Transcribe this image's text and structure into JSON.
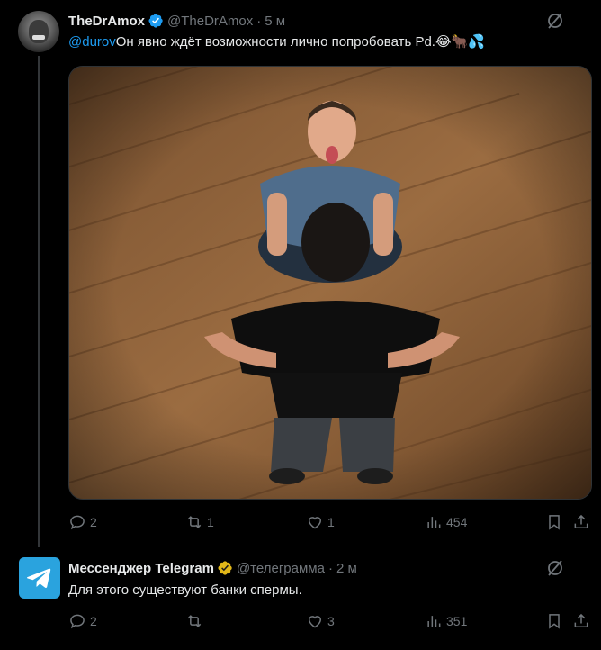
{
  "tweet": {
    "author_name": "TheDrAmox",
    "author_handle": "@TheDrAmox",
    "separator": "·",
    "time": "5 м",
    "mention": "@durov",
    "text": "Он явно ждёт возможности лично попробовать Pd.",
    "emoji": "😂🐂💦",
    "stats": {
      "replies": "2",
      "reposts": "1",
      "likes": "1",
      "views": "454"
    }
  },
  "reply": {
    "author_name": "Мессенджер Telegram",
    "author_handle": "@телеграмма",
    "separator": "·",
    "time": "2 м",
    "text": "Для этого существуют банки спермы.",
    "stats": {
      "replies": "2",
      "reposts": "",
      "likes": "3",
      "views": "351"
    }
  },
  "colors": {
    "background": "#000000",
    "text": "#e7e9ea",
    "muted": "#71767b",
    "accent": "#1d9bf0",
    "verified_gold": "#e2b719",
    "telegram": "#2aa3de"
  },
  "icons": [
    "verified-badge-icon",
    "grok-icon",
    "reply-icon",
    "repost-icon",
    "like-icon",
    "views-icon",
    "bookmark-icon",
    "share-icon",
    "telegram-icon"
  ]
}
